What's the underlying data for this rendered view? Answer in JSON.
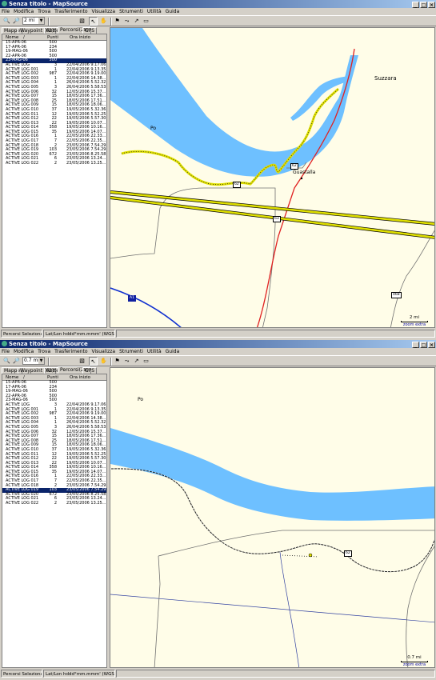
{
  "app_title": "Senza titolo - MapSource",
  "menu": [
    "File",
    "Modifica",
    "Trova",
    "Trasferimento",
    "Visualizza",
    "Strumenti",
    "Utilità",
    "Guida"
  ],
  "tabs": [
    "Mappe",
    "Waypoint (62)",
    "Rotte",
    "Percorsi(28)",
    "GPS"
  ],
  "columns": {
    "name": "Nome",
    "count": "Punti",
    "start": "Ora inizio",
    "sort_glyph": "/"
  },
  "tracks": [
    {
      "name": "15-APR-06",
      "points": "500",
      "start": ""
    },
    {
      "name": "17-APR-06",
      "points": "234",
      "start": ""
    },
    {
      "name": "19-MAG-06",
      "points": "500",
      "start": ""
    },
    {
      "name": "22-APR-06",
      "points": "500",
      "start": ""
    },
    {
      "name": "23-MAG-06",
      "points": "500",
      "start": ""
    },
    {
      "name": "ACTIVE LOG",
      "points": "3",
      "start": "22/04/2006 9.17.06"
    },
    {
      "name": "ACTIVE LOG 001",
      "points": "1",
      "start": "22/04/2006 9.13.35"
    },
    {
      "name": "ACTIVE LOG 002",
      "points": "987",
      "start": "22/04/2006 9.19.00"
    },
    {
      "name": "ACTIVE LOG 003",
      "points": "1",
      "start": "22/04/2006 14.38..."
    },
    {
      "name": "ACTIVE LOG 004",
      "points": "1",
      "start": "26/04/2006 5.52.32"
    },
    {
      "name": "ACTIVE LOG 005",
      "points": "3",
      "start": "26/04/2006 5.58.53"
    },
    {
      "name": "ACTIVE LOG 006",
      "points": "32",
      "start": "12/05/2006 15.37..."
    },
    {
      "name": "ACTIVE LOG 007",
      "points": "15",
      "start": "18/05/2006 17.36..."
    },
    {
      "name": "ACTIVE LOG 008",
      "points": "25",
      "start": "18/05/2006 17.51..."
    },
    {
      "name": "ACTIVE LOG 009",
      "points": "15",
      "start": "18/05/2006 18.06..."
    },
    {
      "name": "ACTIVE LOG 010",
      "points": "37",
      "start": "19/05/2006 5.32.36"
    },
    {
      "name": "ACTIVE LOG 011",
      "points": "12",
      "start": "19/05/2006 5.52.25"
    },
    {
      "name": "ACTIVE LOG 012",
      "points": "22",
      "start": "19/05/2006 5.57.30"
    },
    {
      "name": "ACTIVE LOG 013",
      "points": "22",
      "start": "19/05/2006 10.07..."
    },
    {
      "name": "ACTIVE LOG 014",
      "points": "358",
      "start": "19/05/2006 10.16..."
    },
    {
      "name": "ACTIVE LOG 015",
      "points": "35",
      "start": "19/05/2006 14.07..."
    },
    {
      "name": "ACTIVE LOG 016",
      "points": "1",
      "start": "22/05/2006 22.33..."
    },
    {
      "name": "ACTIVE LOG 017",
      "points": "7",
      "start": "22/05/2006 22.35..."
    },
    {
      "name": "ACTIVE LOG 018",
      "points": "2",
      "start": "23/05/2006 7.54.29"
    },
    {
      "name": "ACTIVE LOG 019",
      "points": "103",
      "start": "23/05/2006 7.54.29"
    },
    {
      "name": "ACTIVE LOG 020",
      "points": "672",
      "start": "23/05/2006 8.25.58"
    },
    {
      "name": "ACTIVE LOG 021",
      "points": "6",
      "start": "23/05/2006 13.24..."
    },
    {
      "name": "ACTIVE LOG 022",
      "points": "2",
      "start": "23/05/2006 13.25..."
    }
  ],
  "window1": {
    "zoom": "2 mi",
    "selected_track": "23-MAG-06",
    "labels": {
      "po": "Po",
      "suzzara": "Suzzara",
      "guastalla": "Guastalla",
      "s62a": "62",
      "s62b": "62",
      "s63": "63",
      "s468": "468",
      "a1": "A1"
    },
    "scale": {
      "distance": "2 mi",
      "zoom": "zoom extra"
    },
    "status": {
      "selection": "Percorsi Selezionati",
      "format": "Lat/Lon hddd°mm.mmm' (WGS 84)"
    }
  },
  "window2": {
    "zoom": "0.7 mi",
    "selected_track": "ACTIVE LOG 019",
    "labels": {
      "po": "Po",
      "s62": "62"
    },
    "scale": {
      "distance": "0.7 mi",
      "zoom": "zoom extra"
    },
    "status": {
      "selection": "Percorsi Selezionati",
      "format": "Lat/Lon hddd°mm.mmm' (WGS 84)"
    }
  },
  "colors": {
    "river": "#6ec0ff",
    "highway": "#e0e000",
    "road_red": "#e02020",
    "road_grey": "#707070",
    "motorway": "#1030d0",
    "track_dot": "#202020",
    "map_bg": "#fffde8",
    "selection": "#0a246a"
  },
  "icons": [
    "zoom-in-icon",
    "zoom-out-icon",
    "select-icon",
    "hand-icon",
    "waypoint-flag-icon",
    "route-icon",
    "distance-icon",
    "measure-icon"
  ]
}
